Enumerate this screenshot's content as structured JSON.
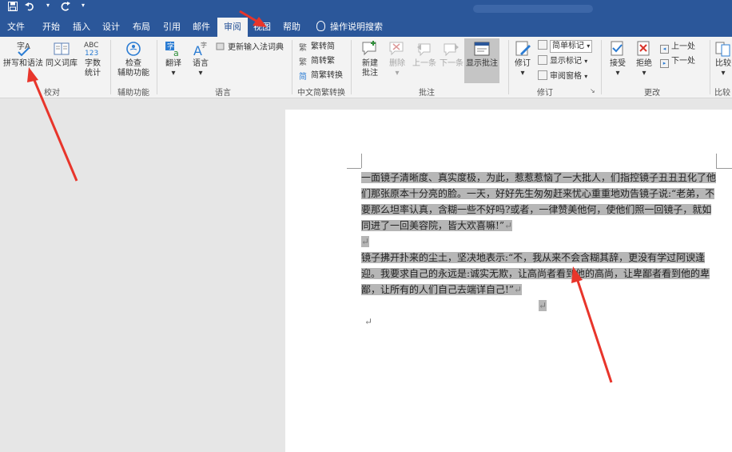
{
  "titlebar": {
    "qat": [
      "save",
      "undo",
      "redo",
      "customize"
    ]
  },
  "tabs": [
    {
      "label": "文件"
    },
    {
      "label": "开始"
    },
    {
      "label": "插入"
    },
    {
      "label": "设计"
    },
    {
      "label": "布局"
    },
    {
      "label": "引用"
    },
    {
      "label": "邮件"
    },
    {
      "label": "审阅"
    },
    {
      "label": "视图"
    },
    {
      "label": "帮助"
    }
  ],
  "tell_me": "操作说明搜索",
  "ribbon": {
    "proofing": {
      "spelling": "拼写和语法",
      "thesaurus": "同义词库",
      "wordcount_1": "字数",
      "wordcount_2": "统计",
      "group": "校对"
    },
    "accessibility": {
      "check_1": "检查",
      "check_2": "辅助功能",
      "group": "辅助功能"
    },
    "language": {
      "translate": "翻译",
      "language": "语言",
      "ime_dict": "更新输入法词典",
      "group": "语言"
    },
    "chinese_conv": {
      "to_simplified": "繁转简",
      "to_traditional": "简转繁",
      "conversion": "简繁转换",
      "group": "中文简繁转换"
    },
    "comments": {
      "new_1": "新建",
      "new_2": "批注",
      "delete": "删除",
      "previous": "上一条",
      "next": "下一条",
      "show": "显示批注",
      "group": "批注"
    },
    "tracking": {
      "track": "修订",
      "simple_markup": "简单标记",
      "show_markup": "显示标记",
      "review_pane": "审阅窗格",
      "group": "修订"
    },
    "changes": {
      "accept": "接受",
      "reject": "拒绝",
      "previous": "上一处",
      "next": "下一处",
      "group": "更改"
    },
    "compare": {
      "compare": "比较",
      "group": "比较"
    }
  },
  "document": {
    "para1": "一面镜子清晰度、真实度极，为此，惹惹惹恼了一大批人，们指控镜子丑丑丑化了他们那张原本十分亮的脸。一天，好好先生匆匆赶来忧心重重地劝告镜子说:“老弟，不要那么坦率认真，含糊一些不好吗?或者，一律赞美他何，使他们照一回镜子，就如同进了一回美容院，皆大欢喜嘛!”",
    "para2": "镜子拂开扑来的尘土，坚决地表示:“不，我从来不会含糊其辞，更没有学过阿谀逢迎。我要求自己的永远是:诚实无欺，让高尚者看到他的高尚，让卑鄙者看到他的卑鄙，让所有的人们自己去端详自己!”",
    "return_mark": "↵"
  }
}
